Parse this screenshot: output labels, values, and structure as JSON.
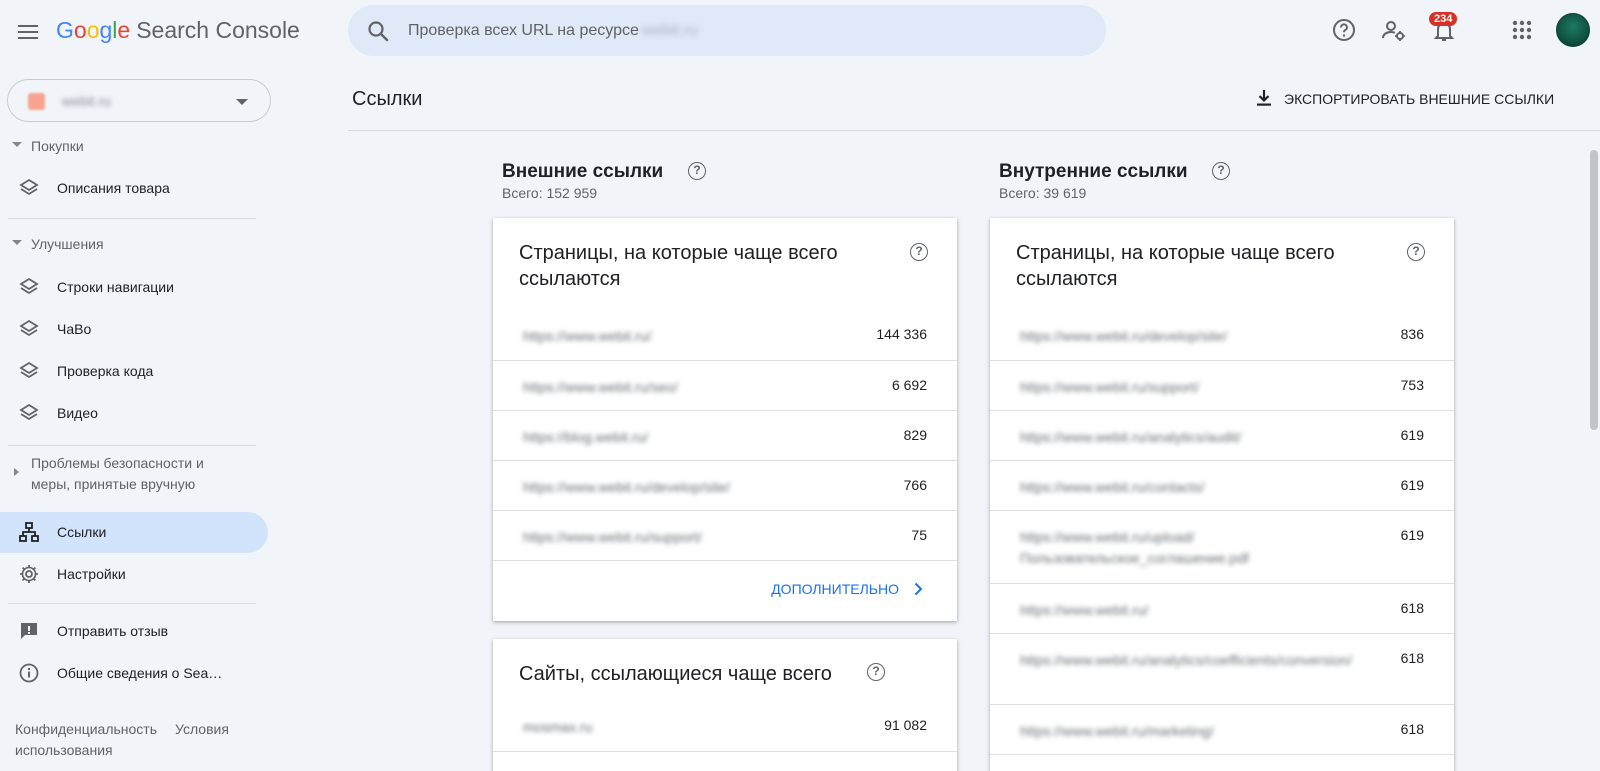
{
  "app": {
    "brand_letters": [
      "G",
      "o",
      "o",
      "g",
      "l",
      "e"
    ],
    "product": "Search Console",
    "notification_count": "234"
  },
  "search": {
    "placeholder": "Проверка всех URL на ресурсе",
    "property_blurred": "webit.ru"
  },
  "sidebar": {
    "property_name": "webit.ru",
    "sections": {
      "shopping": "Покупки",
      "enhancements": "Улучшения",
      "security": "Проблемы безопасности и меры, принятые вручную"
    },
    "items": {
      "product_snippets": "Описания товара",
      "breadcrumbs": "Строки навигации",
      "faq": "ЧаВо",
      "code_check": "Проверка кода",
      "video": "Видео",
      "links": "Ссылки",
      "settings": "Настройки",
      "feedback": "Отправить отзыв",
      "about": "Общие сведения о Sea…"
    },
    "footer": {
      "privacy": "Конфиденциальность",
      "terms": "Условия использования"
    }
  },
  "page": {
    "title": "Ссылки",
    "export_label": "ЭКСПОРТИРОВАТЬ ВНЕШНИЕ ССЫЛКИ"
  },
  "external": {
    "title": "Внешние ссылки",
    "total": "Всего: 152 959",
    "top_pages": {
      "title": "Страницы, на которые чаще всего ссылаются",
      "rows": [
        {
          "url": "https://www.webit.ru/",
          "count": "144 336"
        },
        {
          "url": "https://www.webit.ru/seo/",
          "count": "6 692"
        },
        {
          "url": "https://blog.webit.ru/",
          "count": "829"
        },
        {
          "url": "https://www.webit.ru/develop/site/",
          "count": "766"
        },
        {
          "url": "https://www.webit.ru/support/",
          "count": "75"
        }
      ],
      "more_label": "ДОПОЛНИТЕЛЬНО"
    },
    "top_sites": {
      "title": "Сайты, ссылающиеся чаще всего",
      "rows": [
        {
          "url": "mosmax.ru",
          "count": "91 082"
        }
      ]
    }
  },
  "internal": {
    "title": "Внутренние ссылки",
    "total": "Всего: 39 619",
    "top_pages": {
      "title": "Страницы, на которые чаще всего ссылаются",
      "rows": [
        {
          "url": "https://www.webit.ru/develop/site/",
          "count": "836"
        },
        {
          "url": "https://www.webit.ru/support/",
          "count": "753"
        },
        {
          "url": "https://www.webit.ru/analytics/audit/",
          "count": "619"
        },
        {
          "url": "https://www.webit.ru/contacts/",
          "count": "619"
        },
        {
          "url": "https://www.webit.ru/upload/Пользовательское_соглашение.pdf",
          "count": "619"
        },
        {
          "url": "https://www.webit.ru/",
          "count": "618"
        },
        {
          "url": "https://www.webit.ru/analytics/coefficients/conversion/",
          "count": "618"
        },
        {
          "url": "https://www.webit.ru/marketing/",
          "count": "618"
        }
      ]
    }
  }
}
